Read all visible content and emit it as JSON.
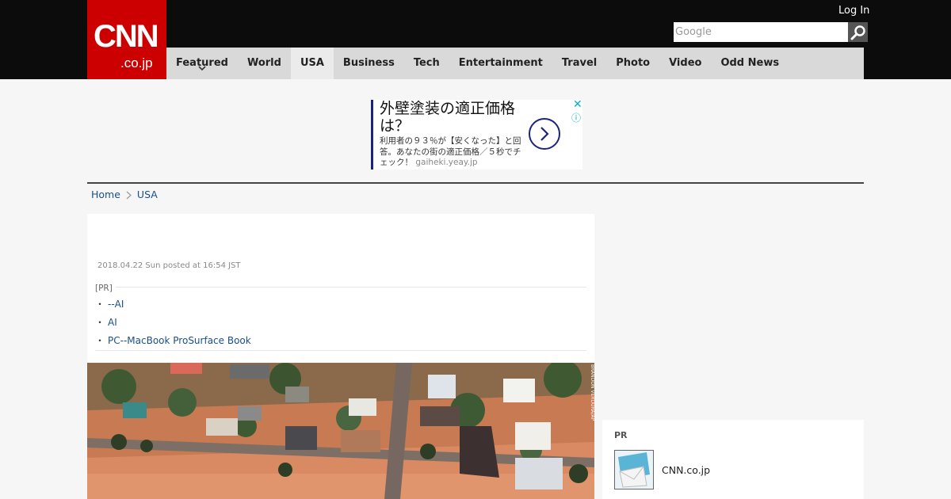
{
  "header": {
    "logo": {
      "brand": "CNN",
      "sub": ".co.jp",
      "color": "#cc0000"
    },
    "login_label": "Log In",
    "search": {
      "placeholder": "Google",
      "value": ""
    },
    "icons": {
      "search": "search-icon",
      "caret": "chevron-down-icon"
    }
  },
  "nav": {
    "items": [
      {
        "label": "Featured"
      },
      {
        "label": "World"
      },
      {
        "label": "USA"
      },
      {
        "label": "Business"
      },
      {
        "label": "Tech"
      },
      {
        "label": "Entertainment"
      },
      {
        "label": "Travel"
      },
      {
        "label": "Photo"
      },
      {
        "label": "Video"
      },
      {
        "label": "Odd News"
      }
    ],
    "active": "USA"
  },
  "ad": {
    "headline": "外壁塗装の適正価格は？",
    "body": "利用者の９３％が【安くなった】と回答。あなたの街の適正価格／５秒でチェック！",
    "domain": "gaiheki.yeay.jp",
    "close": "✕",
    "info": "ⓘ"
  },
  "breadcrumb": {
    "home": "Home",
    "current": "USA"
  },
  "article": {
    "date": "2018.04.22 Sun posted at 16:54 JST",
    "pr_label": "[PR]",
    "pr_links": [
      "--AI",
      "AI",
      "PC--MacBook ProSurface Book"
    ],
    "bullet": "・",
    "photo_credit": "BRANDON VERDURA/AP"
  },
  "sidebar": {
    "pr_label": "PR",
    "link_label": "CNN.co.jp"
  }
}
